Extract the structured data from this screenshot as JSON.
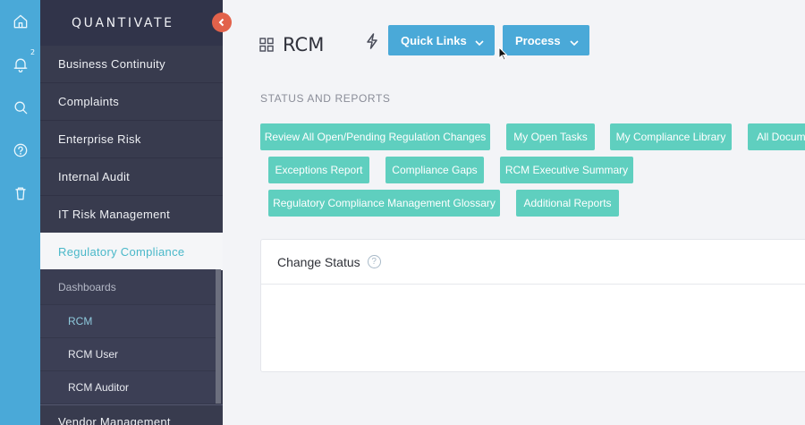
{
  "rail": {
    "icons": [
      "home-icon",
      "bell-icon",
      "search-icon",
      "help-icon",
      "trash-icon"
    ],
    "notification_count": "2"
  },
  "sidebar": {
    "brand": "QUANTIVATE",
    "items": [
      {
        "label": "Business Continuity"
      },
      {
        "label": "Complaints"
      },
      {
        "label": "Enterprise Risk"
      },
      {
        "label": "Internal Audit"
      },
      {
        "label": "IT Risk Management"
      },
      {
        "label": "Regulatory Compliance"
      }
    ],
    "group_label": "Dashboards",
    "sub_items": [
      {
        "label": "RCM"
      },
      {
        "label": "RCM User"
      },
      {
        "label": "RCM Auditor"
      }
    ],
    "last_item": "Vendor Management"
  },
  "header": {
    "title": "RCM",
    "quick_links_label": "Quick Links",
    "process_label": "Process"
  },
  "status_reports": {
    "section_label": "STATUS AND REPORTS",
    "buttons": [
      {
        "label": "Review All Open/Pending Regulation Changes"
      },
      {
        "label": "My Open Tasks"
      },
      {
        "label": "My Compliance Library"
      },
      {
        "label": "All Documents"
      },
      {
        "label": "Exceptions Report"
      },
      {
        "label": "Compliance Gaps"
      },
      {
        "label": "RCM Executive Summary"
      },
      {
        "label": "Regulatory Compliance Management Glossary"
      },
      {
        "label": "Additional Reports"
      }
    ]
  },
  "change_status": {
    "title": "Change Status",
    "help": "?"
  },
  "colors": {
    "rail": "#4aa9d8",
    "sidebar": "#383b4e",
    "accent_teal": "#5fcfbf",
    "primary_blue": "#4aa9d8",
    "collapse_red": "#e2624b"
  }
}
